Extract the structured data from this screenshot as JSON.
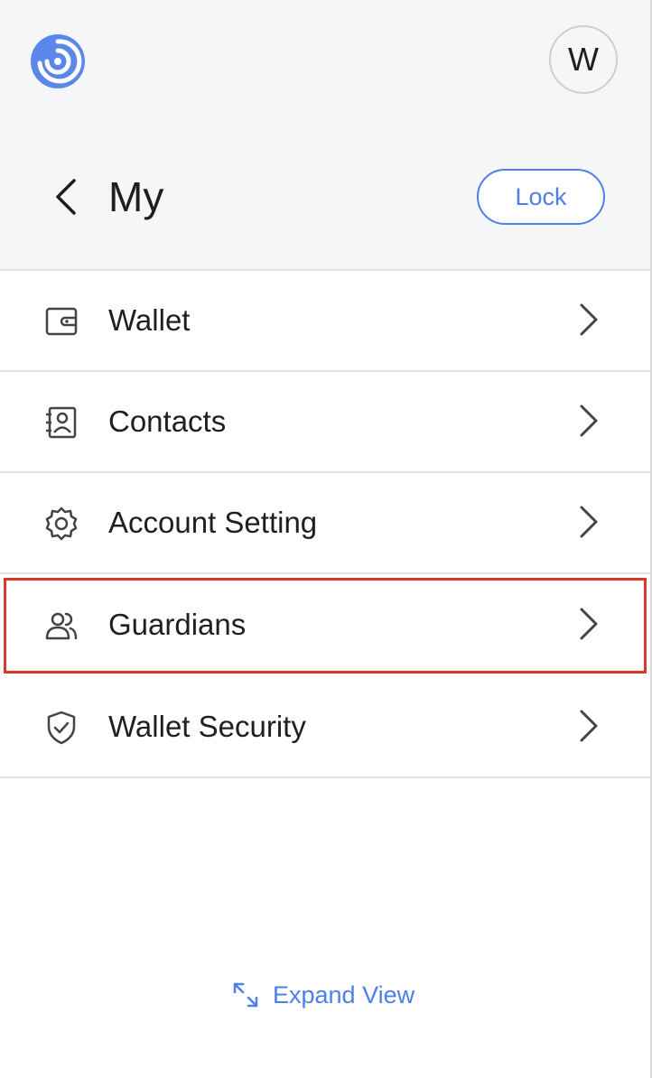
{
  "header": {
    "avatar_initial": "W",
    "title": "My",
    "lock_label": "Lock"
  },
  "menu": {
    "items": [
      {
        "label": "Wallet",
        "icon": "wallet-icon"
      },
      {
        "label": "Contacts",
        "icon": "contacts-icon"
      },
      {
        "label": "Account Setting",
        "icon": "gear-icon"
      },
      {
        "label": "Guardians",
        "icon": "users-icon"
      },
      {
        "label": "Wallet Security",
        "icon": "shield-check-icon"
      }
    ]
  },
  "footer": {
    "expand_label": "Expand View"
  },
  "colors": {
    "accent": "#4e7fe8",
    "highlight": "#d63a2c",
    "header_bg": "#f5f6f8"
  }
}
